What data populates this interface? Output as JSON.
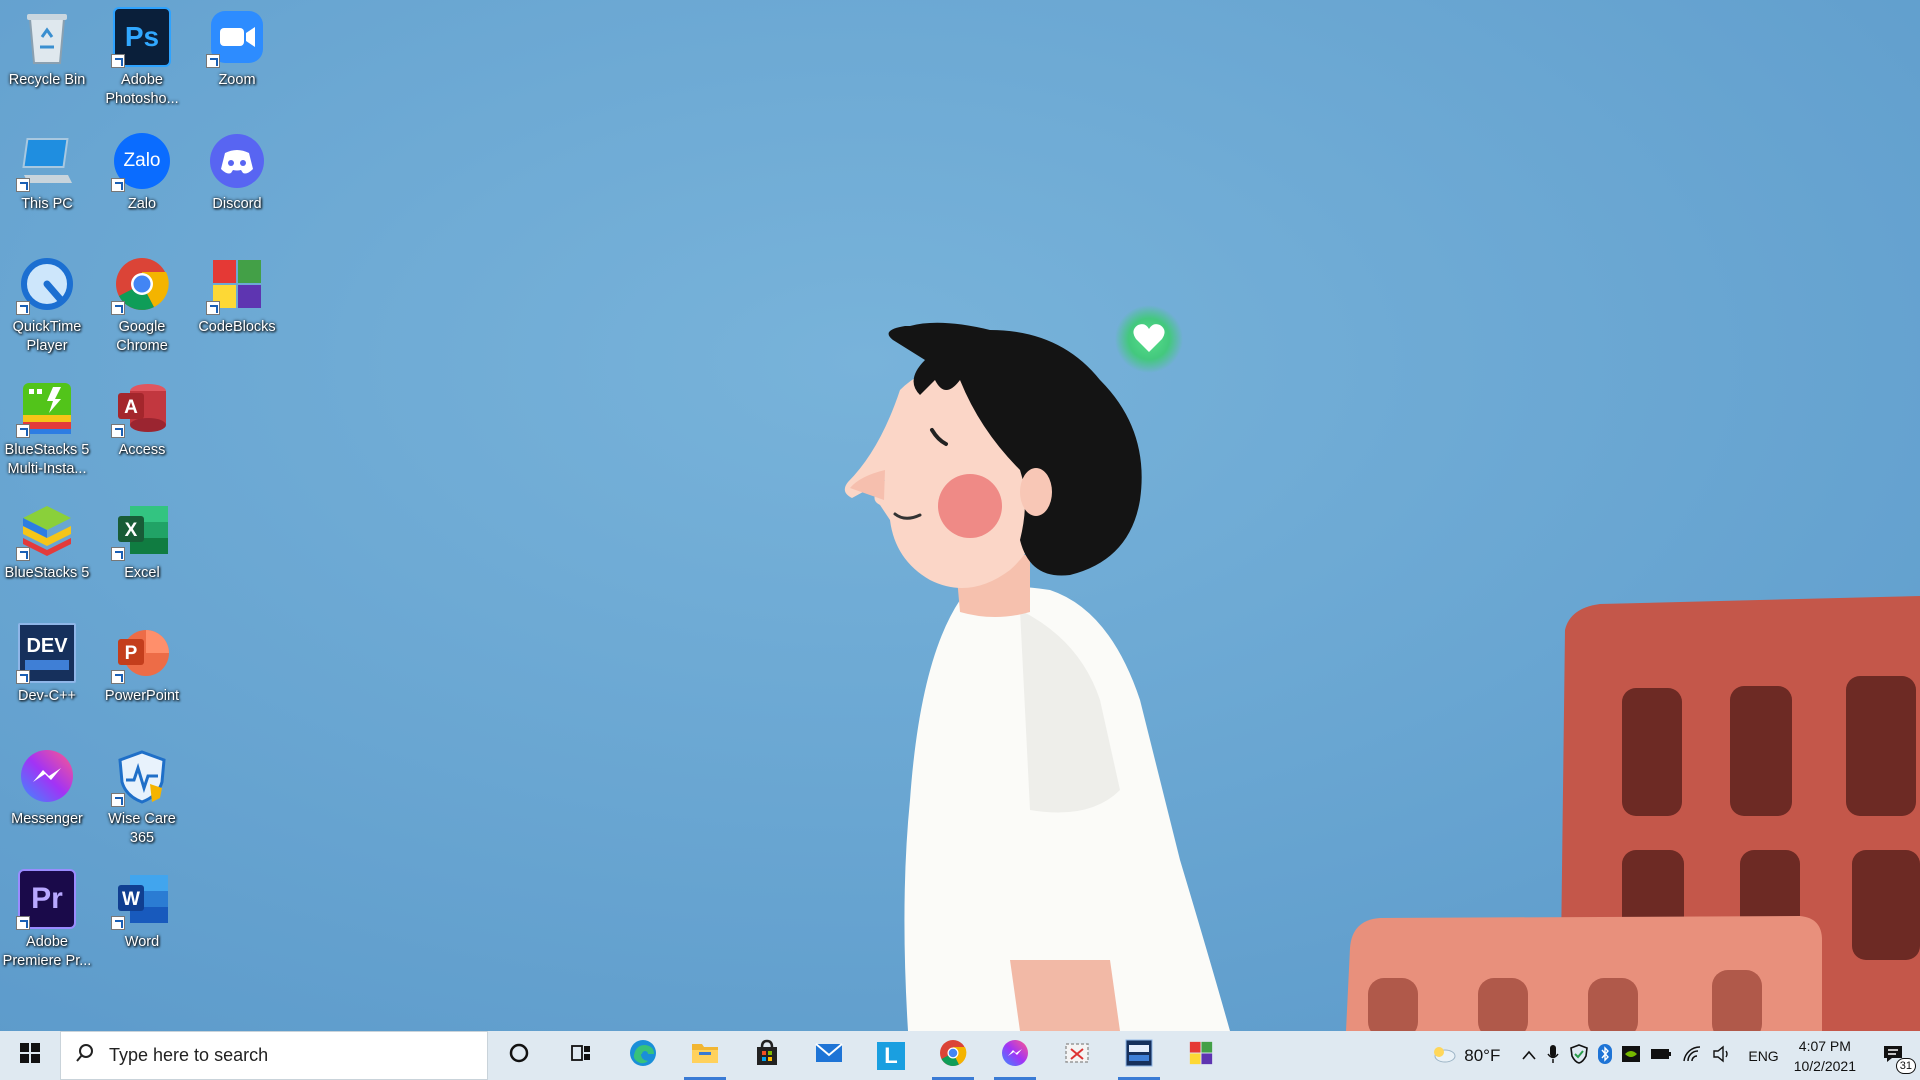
{
  "desktop": {
    "icons": [
      {
        "label": "Recycle Bin",
        "icon": "recycle-bin-icon"
      },
      {
        "label": "Adobe\nPhotosho...",
        "icon": "photoshop-icon"
      },
      {
        "label": "Zoom",
        "icon": "zoom-icon"
      },
      {
        "label": "This PC",
        "icon": "this-pc-icon"
      },
      {
        "label": "Zalo",
        "icon": "zalo-icon"
      },
      {
        "label": "Discord",
        "icon": "discord-icon"
      },
      {
        "label": "QuickTime\nPlayer",
        "icon": "quicktime-icon"
      },
      {
        "label": "Google\nChrome",
        "icon": "chrome-icon"
      },
      {
        "label": "CodeBlocks",
        "icon": "codeblocks-icon"
      },
      {
        "label": "BlueStacks 5\nMulti-Insta...",
        "icon": "bluestacks-multi-icon"
      },
      {
        "label": "Access",
        "icon": "access-icon"
      },
      {
        "label": "BlueStacks 5",
        "icon": "bluestacks-icon"
      },
      {
        "label": "Excel",
        "icon": "excel-icon"
      },
      {
        "label": "Dev-C++",
        "icon": "devcpp-icon"
      },
      {
        "label": "PowerPoint",
        "icon": "powerpoint-icon"
      },
      {
        "label": "Messenger",
        "icon": "messenger-icon"
      },
      {
        "label": "Wise Care\n365",
        "icon": "wisecare-icon"
      },
      {
        "label": "Adobe\nPremiere Pr...",
        "icon": "premiere-icon"
      },
      {
        "label": "Word",
        "icon": "word-icon"
      }
    ],
    "tile_text": {
      "ps": "Ps",
      "zalo": "Zalo",
      "access": "A",
      "excel": "X",
      "dev": "DEV",
      "ppt": "P",
      "pr": "Pr",
      "word": "W"
    }
  },
  "taskbar": {
    "search_placeholder": "Type here to search",
    "pinned": [
      {
        "name": "cortana",
        "icon": "cortana-icon"
      },
      {
        "name": "task-view",
        "icon": "task-view-icon"
      },
      {
        "name": "edge",
        "icon": "edge-icon"
      },
      {
        "name": "file-explorer",
        "icon": "file-explorer-icon"
      },
      {
        "name": "store",
        "icon": "store-icon"
      },
      {
        "name": "mail",
        "icon": "mail-icon"
      },
      {
        "name": "l-app",
        "icon": "l-app-icon"
      },
      {
        "name": "chrome",
        "icon": "chrome-icon"
      },
      {
        "name": "messenger",
        "icon": "messenger-icon"
      },
      {
        "name": "snipping",
        "icon": "snipping-icon"
      },
      {
        "name": "devcpp",
        "icon": "devcpp-icon"
      },
      {
        "name": "codeblocks",
        "icon": "codeblocks-icon"
      }
    ],
    "l_app_letter": "L",
    "weather": "80°F",
    "language": "ENG",
    "time": "4:07 PM",
    "date": "10/2/2021",
    "notifications_count": "31"
  },
  "colors": {
    "wallpaper_sky": "#6ea9d3",
    "taskbar_bg": "#dfe9f1",
    "accent": "#3a7bd5"
  }
}
